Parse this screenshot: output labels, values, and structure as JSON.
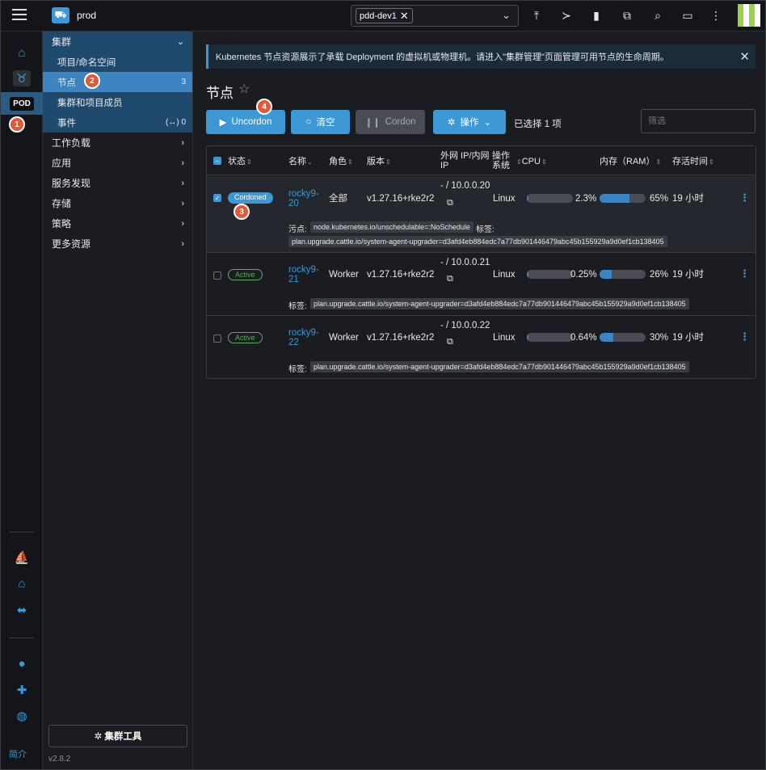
{
  "header": {
    "cluster_name": "prod",
    "namespace_chip": "pdd-dev1",
    "icons": [
      "upload-icon",
      "terminal-icon",
      "file-icon",
      "copy-config-icon",
      "search-icon",
      "book-icon",
      "more-vert-icon"
    ]
  },
  "rail": {
    "pod_label": "POD",
    "bottom_label": "简介"
  },
  "nav": {
    "groups": [
      {
        "label": "集群"
      },
      {
        "label": "工作负载"
      },
      {
        "label": "应用"
      },
      {
        "label": "服务发现"
      },
      {
        "label": "存储"
      },
      {
        "label": "策略"
      },
      {
        "label": "更多资源"
      }
    ],
    "cluster_items": [
      {
        "label": "项目/命名空间",
        "count": ""
      },
      {
        "label": "节点",
        "count": "3"
      },
      {
        "label": "集群和项目成员",
        "count": ""
      },
      {
        "label": "事件",
        "count": "(↔) 0"
      }
    ],
    "tool_button": "集群工具",
    "version": "v2.8.2"
  },
  "main": {
    "banner_text": "Kubernetes 节点资源展示了承载 Deployment 的虚拟机或物理机。请进入\"集群管理\"页面管理可用节点的生命周期。",
    "title": "节点",
    "buttons": {
      "uncordon": "Uncordon",
      "drain": "清空",
      "cordon": "Cordon",
      "actions": "操作"
    },
    "selected_text": "已选择 1 项",
    "filter_placeholder": "筛选",
    "columns": {
      "state": "状态",
      "name": "名称",
      "role": "角色",
      "version": "版本",
      "ip": "外网 IP/内网 IP",
      "os": "操作系统",
      "cpu": "CPU",
      "ram": "内存（RAM）",
      "age": "存活时间"
    },
    "rows": [
      {
        "state": "Cordoned",
        "name": "rocky9-20",
        "role": "全部",
        "version": "v1.27.16+rke2r2",
        "ip": "- / 10.0.0.20",
        "os": "Linux",
        "cpu": "2.3%",
        "cpu_fraction": 0.023,
        "ram": "65%",
        "ram_fraction": 0.65,
        "age": "19 小时",
        "taint_label": "污点:",
        "taint": "node.kubernetes.io/unschedulable=:NoSchedule",
        "tag_label": "标签:",
        "tag": "plan.upgrade.cattle.io/system-agent-upgrader=d3afd4eb884edc7a77db901446479abc45b155929a9d0ef1cb138405"
      },
      {
        "state": "Active",
        "name": "rocky9-21",
        "role": "Worker",
        "version": "v1.27.16+rke2r2",
        "ip": "- / 10.0.0.21",
        "os": "Linux",
        "cpu": "0.25%",
        "cpu_fraction": 0.0025,
        "ram": "26%",
        "ram_fraction": 0.26,
        "age": "19 小时",
        "tag_label": "标签:",
        "tag": "plan.upgrade.cattle.io/system-agent-upgrader=d3afd4eb884edc7a77db901446479abc45b155929a9d0ef1cb138405"
      },
      {
        "state": "Active",
        "name": "rocky9-22",
        "role": "Worker",
        "version": "v1.27.16+rke2r2",
        "ip": "- / 10.0.0.22",
        "os": "Linux",
        "cpu": "0.64%",
        "cpu_fraction": 0.0064,
        "ram": "30%",
        "ram_fraction": 0.3,
        "age": "19 小时",
        "tag_label": "标签:",
        "tag": "plan.upgrade.cattle.io/system-agent-upgrader=d3afd4eb884edc7a77db901446479abc45b155929a9d0ef1cb138405"
      }
    ]
  },
  "steps": [
    "1",
    "2",
    "3",
    "4"
  ],
  "colors": {
    "accent": "#3d98d3",
    "step_marker": "#e05a3a",
    "active_status": "#5fa85f"
  }
}
